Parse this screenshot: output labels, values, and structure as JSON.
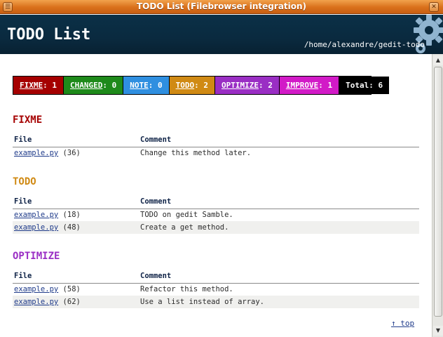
{
  "window": {
    "title": "TODO List (Filebrowser integration)",
    "left_button": "☰",
    "close_button": "✕"
  },
  "header": {
    "title": "TODO List",
    "path": "/home/alexandre/gedit-todo",
    "bg": "#0a2a3f"
  },
  "summary": {
    "items": [
      {
        "label": "FIXME",
        "sep": ": ",
        "count": "1",
        "color": "#a50000"
      },
      {
        "label": "CHANGED",
        "sep": ": ",
        "count": "0",
        "color": "#1e8a1a"
      },
      {
        "label": "NOTE",
        "sep": ": ",
        "count": "0",
        "color": "#2f8fe0"
      },
      {
        "label": "TODO",
        "sep": ": ",
        "count": "2",
        "color": "#d08a14"
      },
      {
        "label": "OPTIMIZE",
        "sep": ": ",
        "count": "2",
        "color": "#9a2ec4"
      },
      {
        "label": "IMPROVE",
        "sep": ": ",
        "count": "1",
        "color": "#d21ac7"
      },
      {
        "label": "Total",
        "sep": ": ",
        "count": "6",
        "color": "#000000"
      }
    ]
  },
  "sections": [
    {
      "title": "FIXME",
      "color": "#a50000",
      "col_file": "File",
      "col_comment": "Comment",
      "rows": [
        {
          "file": "example.py",
          "line": "(36)",
          "comment": "Change this method later."
        }
      ]
    },
    {
      "title": "TODO",
      "color": "#d08a14",
      "col_file": "File",
      "col_comment": "Comment",
      "rows": [
        {
          "file": "example.py",
          "line": "(18)",
          "comment": "TODO on gedit Samble."
        },
        {
          "file": "example.py",
          "line": "(48)",
          "comment": "Create a get method."
        }
      ]
    },
    {
      "title": "OPTIMIZE",
      "color": "#9a2ec4",
      "col_file": "File",
      "col_comment": "Comment",
      "rows": [
        {
          "file": "example.py",
          "line": "(58)",
          "comment": "Refactor this method."
        },
        {
          "file": "example.py",
          "line": "(62)",
          "comment": "Use a list instead of array."
        }
      ]
    }
  ],
  "footer": {
    "top_link": "↑ top"
  },
  "scrollbar": {
    "up_arrow": "▲",
    "down_arrow": "▼"
  }
}
